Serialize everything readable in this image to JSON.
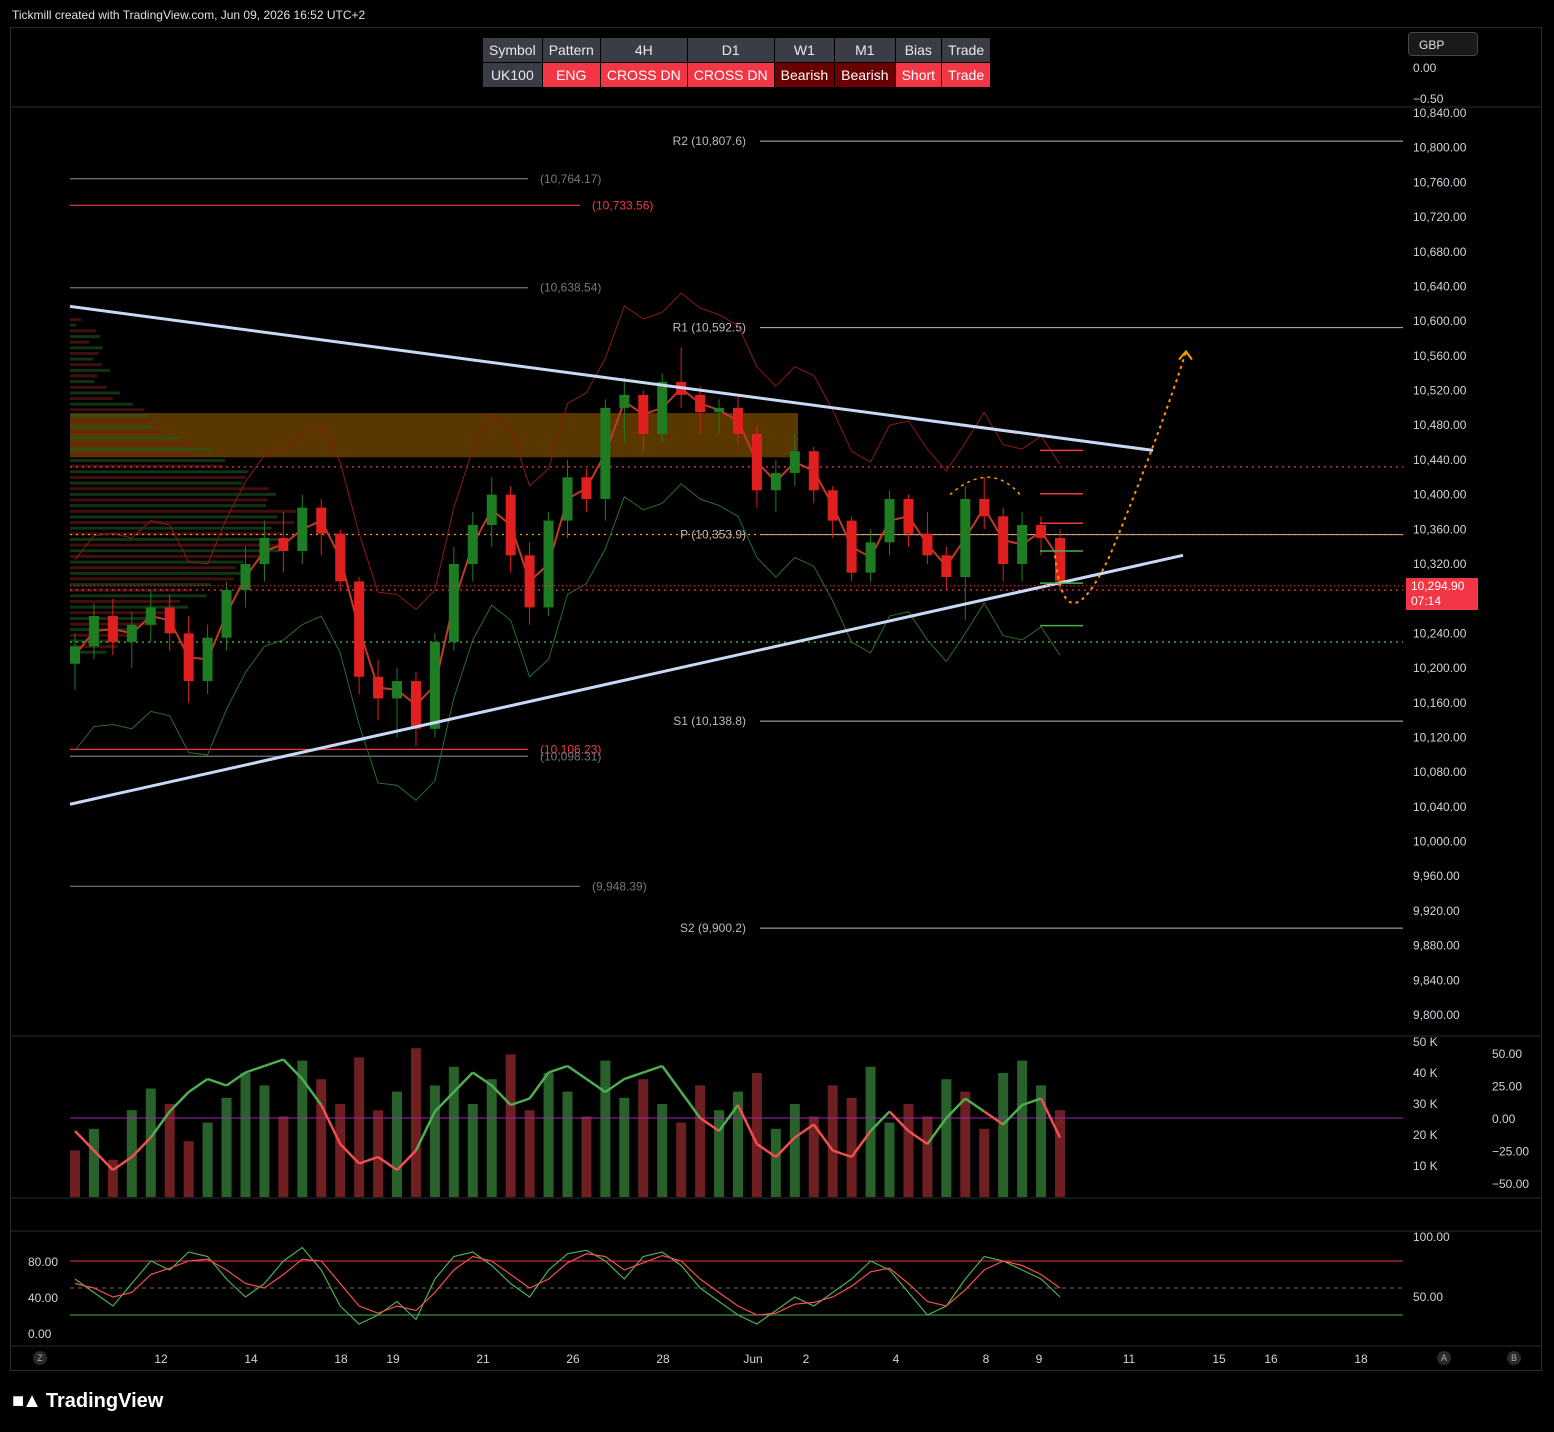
{
  "header": {
    "text": "Tickmill created with TradingView.com, Jun 09, 2026 16:52 UTC+2"
  },
  "footer": {
    "logo_text": "TradingView"
  },
  "currency": "GBP",
  "signal_table": {
    "headers": [
      "Symbol",
      "Pattern",
      "4H",
      "D1",
      "W1",
      "M1",
      "Bias",
      "Trade"
    ],
    "row": [
      {
        "text": "UK100",
        "style": "gray"
      },
      {
        "text": "ENG",
        "style": "red"
      },
      {
        "text": "CROSS DN",
        "style": "red"
      },
      {
        "text": "CROSS DN",
        "style": "red"
      },
      {
        "text": "Bearish",
        "style": "dred"
      },
      {
        "text": "Bearish",
        "style": "dred"
      },
      {
        "text": "Short",
        "style": "red"
      },
      {
        "text": "Trade",
        "style": "red"
      }
    ]
  },
  "last_price": {
    "value": "10,294.90",
    "countdown": "07:14"
  },
  "corner_buttons": {
    "z": "Z",
    "a": "A",
    "b": "B"
  },
  "colors": {
    "up": "#1e7d22",
    "down": "#e01f1f",
    "trendline": "#c8d8f5",
    "zone": "#7a4a00",
    "accent_orange": "#ff9800",
    "red_level": "#f23645",
    "gray_level": "#555555"
  },
  "chart_data": [
    {
      "type": "candlestick",
      "title": "",
      "ylim": [
        9780,
        10860
      ],
      "y_ticks": [
        "10,840.00",
        "10,800.00",
        "10,760.00",
        "10,720.00",
        "10,680.00",
        "10,640.00",
        "10,600.00",
        "10,560.00",
        "10,520.00",
        "10,480.00",
        "10,440.00",
        "10,400.00",
        "10,360.00",
        "10,320.00",
        "10,280.00",
        "10,240.00",
        "10,200.00",
        "10,160.00",
        "10,120.00",
        "10,080.00",
        "10,040.00",
        "10,000.00",
        "9,960.00",
        "9,920.00",
        "9,880.00",
        "9,840.00",
        "9,800.00"
      ],
      "x_ticks": [
        "Z",
        "12",
        "14",
        "18",
        "19",
        "21",
        "26",
        "28",
        "Jun",
        "2",
        "4",
        "8",
        "9",
        "11",
        "15",
        "16",
        "18"
      ],
      "pivot_levels": [
        {
          "label": "R2 (10,807.6)",
          "value": 10807.6
        },
        {
          "label": "R1 (10,592.5)",
          "value": 10592.5
        },
        {
          "label": "P (10,353.9)",
          "value": 10353.9
        },
        {
          "label": "S1 (10,138.8)",
          "value": 10138.8
        },
        {
          "label": "S2 (9,900.2)",
          "value": 9900.2
        }
      ],
      "horizontal_levels": [
        {
          "label": "(10,764.17)",
          "value": 10764.17,
          "color": "gray"
        },
        {
          "label": "(10,733.56)",
          "value": 10733.56,
          "color": "red"
        },
        {
          "label": "(10,638.54)",
          "value": 10638.54,
          "color": "gray"
        },
        {
          "label": "(10,106.23)",
          "value": 10106.23,
          "color": "red"
        },
        {
          "label": "(10,098.31)",
          "value": 10098.31,
          "color": "gray"
        },
        {
          "label": "(9,948.39)",
          "value": 9948.39,
          "color": "gray"
        }
      ],
      "dotted_levels": [
        {
          "value": 10432,
          "color": "red"
        },
        {
          "value": 10354,
          "color": "orange"
        },
        {
          "value": 10290,
          "color": "red"
        },
        {
          "value": 10230,
          "color": "green"
        }
      ],
      "zone": {
        "from": 10443,
        "to": 10494
      },
      "trendlines": [
        {
          "from_value": 10617,
          "to_value": 10451
        },
        {
          "from_value": 10043,
          "to_value": 10330
        }
      ],
      "trade_marks": [
        10451,
        10401,
        10367,
        10335,
        10298,
        10249
      ],
      "last_price": 10294.9,
      "candles": [
        {
          "o": 10205,
          "h": 10240,
          "l": 10175,
          "c": 10225
        },
        {
          "o": 10225,
          "h": 10275,
          "l": 10210,
          "c": 10260
        },
        {
          "o": 10260,
          "h": 10280,
          "l": 10215,
          "c": 10230
        },
        {
          "o": 10230,
          "h": 10265,
          "l": 10200,
          "c": 10250
        },
        {
          "o": 10250,
          "h": 10290,
          "l": 10230,
          "c": 10270
        },
        {
          "o": 10270,
          "h": 10285,
          "l": 10220,
          "c": 10240
        },
        {
          "o": 10240,
          "h": 10260,
          "l": 10160,
          "c": 10185
        },
        {
          "o": 10185,
          "h": 10250,
          "l": 10170,
          "c": 10235
        },
        {
          "o": 10235,
          "h": 10300,
          "l": 10220,
          "c": 10290
        },
        {
          "o": 10290,
          "h": 10340,
          "l": 10270,
          "c": 10320
        },
        {
          "o": 10320,
          "h": 10370,
          "l": 10300,
          "c": 10350
        },
        {
          "o": 10350,
          "h": 10380,
          "l": 10310,
          "c": 10335
        },
        {
          "o": 10335,
          "h": 10400,
          "l": 10320,
          "c": 10385
        },
        {
          "o": 10385,
          "h": 10395,
          "l": 10330,
          "c": 10355
        },
        {
          "o": 10355,
          "h": 10360,
          "l": 10290,
          "c": 10300
        },
        {
          "o": 10300,
          "h": 10305,
          "l": 10170,
          "c": 10190
        },
        {
          "o": 10190,
          "h": 10210,
          "l": 10140,
          "c": 10165
        },
        {
          "o": 10165,
          "h": 10200,
          "l": 10120,
          "c": 10185
        },
        {
          "o": 10185,
          "h": 10195,
          "l": 10110,
          "c": 10130
        },
        {
          "o": 10130,
          "h": 10240,
          "l": 10120,
          "c": 10230
        },
        {
          "o": 10230,
          "h": 10340,
          "l": 10220,
          "c": 10320
        },
        {
          "o": 10320,
          "h": 10380,
          "l": 10300,
          "c": 10365
        },
        {
          "o": 10365,
          "h": 10420,
          "l": 10340,
          "c": 10400
        },
        {
          "o": 10400,
          "h": 10410,
          "l": 10310,
          "c": 10330
        },
        {
          "o": 10330,
          "h": 10345,
          "l": 10250,
          "c": 10270
        },
        {
          "o": 10270,
          "h": 10380,
          "l": 10260,
          "c": 10370
        },
        {
          "o": 10370,
          "h": 10440,
          "l": 10350,
          "c": 10420
        },
        {
          "o": 10420,
          "h": 10430,
          "l": 10380,
          "c": 10395
        },
        {
          "o": 10395,
          "h": 10510,
          "l": 10370,
          "c": 10500
        },
        {
          "o": 10500,
          "h": 10535,
          "l": 10460,
          "c": 10515
        },
        {
          "o": 10515,
          "h": 10520,
          "l": 10450,
          "c": 10470
        },
        {
          "o": 10470,
          "h": 10540,
          "l": 10460,
          "c": 10530
        },
        {
          "o": 10530,
          "h": 10570,
          "l": 10500,
          "c": 10515
        },
        {
          "o": 10515,
          "h": 10525,
          "l": 10470,
          "c": 10495
        },
        {
          "o": 10495,
          "h": 10510,
          "l": 10470,
          "c": 10500
        },
        {
          "o": 10500,
          "h": 10515,
          "l": 10460,
          "c": 10470
        },
        {
          "o": 10470,
          "h": 10480,
          "l": 10385,
          "c": 10405
        },
        {
          "o": 10405,
          "h": 10440,
          "l": 10380,
          "c": 10425
        },
        {
          "o": 10425,
          "h": 10470,
          "l": 10410,
          "c": 10450
        },
        {
          "o": 10450,
          "h": 10455,
          "l": 10390,
          "c": 10405
        },
        {
          "o": 10405,
          "h": 10410,
          "l": 10350,
          "c": 10370
        },
        {
          "o": 10370,
          "h": 10375,
          "l": 10300,
          "c": 10310
        },
        {
          "o": 10310,
          "h": 10360,
          "l": 10300,
          "c": 10345
        },
        {
          "o": 10345,
          "h": 10405,
          "l": 10330,
          "c": 10395
        },
        {
          "o": 10395,
          "h": 10400,
          "l": 10340,
          "c": 10355
        },
        {
          "o": 10355,
          "h": 10380,
          "l": 10320,
          "c": 10330
        },
        {
          "o": 10330,
          "h": 10340,
          "l": 10290,
          "c": 10305
        },
        {
          "o": 10305,
          "h": 10410,
          "l": 10255,
          "c": 10395
        },
        {
          "o": 10395,
          "h": 10420,
          "l": 10360,
          "c": 10375
        },
        {
          "o": 10375,
          "h": 10385,
          "l": 10300,
          "c": 10320
        },
        {
          "o": 10320,
          "h": 10380,
          "l": 10300,
          "c": 10365
        },
        {
          "o": 10365,
          "h": 10375,
          "l": 10330,
          "c": 10350
        },
        {
          "o": 10350,
          "h": 10360,
          "l": 10290,
          "c": 10300
        }
      ],
      "oscillator_panel": {
        "y_ticks_left": [
          "50 K",
          "40 K",
          "30 K",
          "20 K",
          "10 K"
        ],
        "y_ticks_right": [
          "50.00",
          "25.00",
          "0.00",
          "−25.00",
          "−50.00"
        ],
        "volume": [
          15,
          22,
          12,
          28,
          35,
          30,
          18,
          24,
          32,
          40,
          36,
          26,
          44,
          38,
          30,
          45,
          28,
          34,
          48,
          36,
          42,
          30,
          38,
          46,
          28,
          40,
          34,
          26,
          44,
          32,
          38,
          30,
          24,
          36,
          28,
          34,
          40,
          22,
          30,
          26,
          36,
          32,
          42,
          24,
          30,
          26,
          38,
          34,
          22,
          40,
          44,
          36,
          28
        ],
        "volume_up": [
          false,
          true,
          false,
          true,
          true,
          false,
          false,
          true,
          true,
          true,
          true,
          false,
          true,
          false,
          false,
          false,
          false,
          true,
          false,
          true,
          true,
          true,
          true,
          false,
          false,
          true,
          true,
          false,
          true,
          true,
          false,
          true,
          false,
          false,
          true,
          true,
          false,
          true,
          true,
          false,
          false,
          false,
          true,
          true,
          false,
          false,
          true,
          false,
          false,
          true,
          true,
          true,
          false
        ],
        "oscillator": [
          -10,
          -25,
          -40,
          -30,
          -15,
          5,
          20,
          30,
          25,
          35,
          40,
          45,
          30,
          10,
          -20,
          -35,
          -30,
          -40,
          -25,
          5,
          20,
          35,
          25,
          10,
          15,
          35,
          40,
          30,
          20,
          30,
          35,
          40,
          20,
          0,
          -10,
          10,
          -20,
          -30,
          -15,
          -5,
          -25,
          -30,
          -10,
          5,
          -10,
          -20,
          0,
          15,
          5,
          -5,
          10,
          15,
          -15
        ]
      },
      "stoch_panel": {
        "y_ticks_left": [
          "80.00",
          "40.00",
          "0.00"
        ],
        "y_ticks_right": [
          "100.00",
          "50.00"
        ],
        "k": [
          60,
          45,
          30,
          55,
          80,
          70,
          90,
          85,
          60,
          40,
          55,
          80,
          95,
          70,
          30,
          10,
          20,
          35,
          15,
          60,
          85,
          90,
          75,
          55,
          40,
          70,
          88,
          92,
          80,
          60,
          85,
          90,
          75,
          50,
          35,
          20,
          10,
          25,
          40,
          30,
          45,
          60,
          80,
          70,
          45,
          20,
          30,
          60,
          85,
          80,
          70,
          60,
          40
        ],
        "d": [
          55,
          50,
          40,
          45,
          65,
          72,
          80,
          82,
          70,
          55,
          50,
          65,
          82,
          80,
          55,
          30,
          22,
          30,
          25,
          45,
          70,
          85,
          80,
          65,
          50,
          60,
          78,
          88,
          85,
          70,
          78,
          86,
          80,
          60,
          45,
          30,
          20,
          22,
          32,
          34,
          40,
          52,
          68,
          72,
          55,
          35,
          30,
          48,
          70,
          80,
          75,
          65,
          50
        ]
      }
    }
  ]
}
